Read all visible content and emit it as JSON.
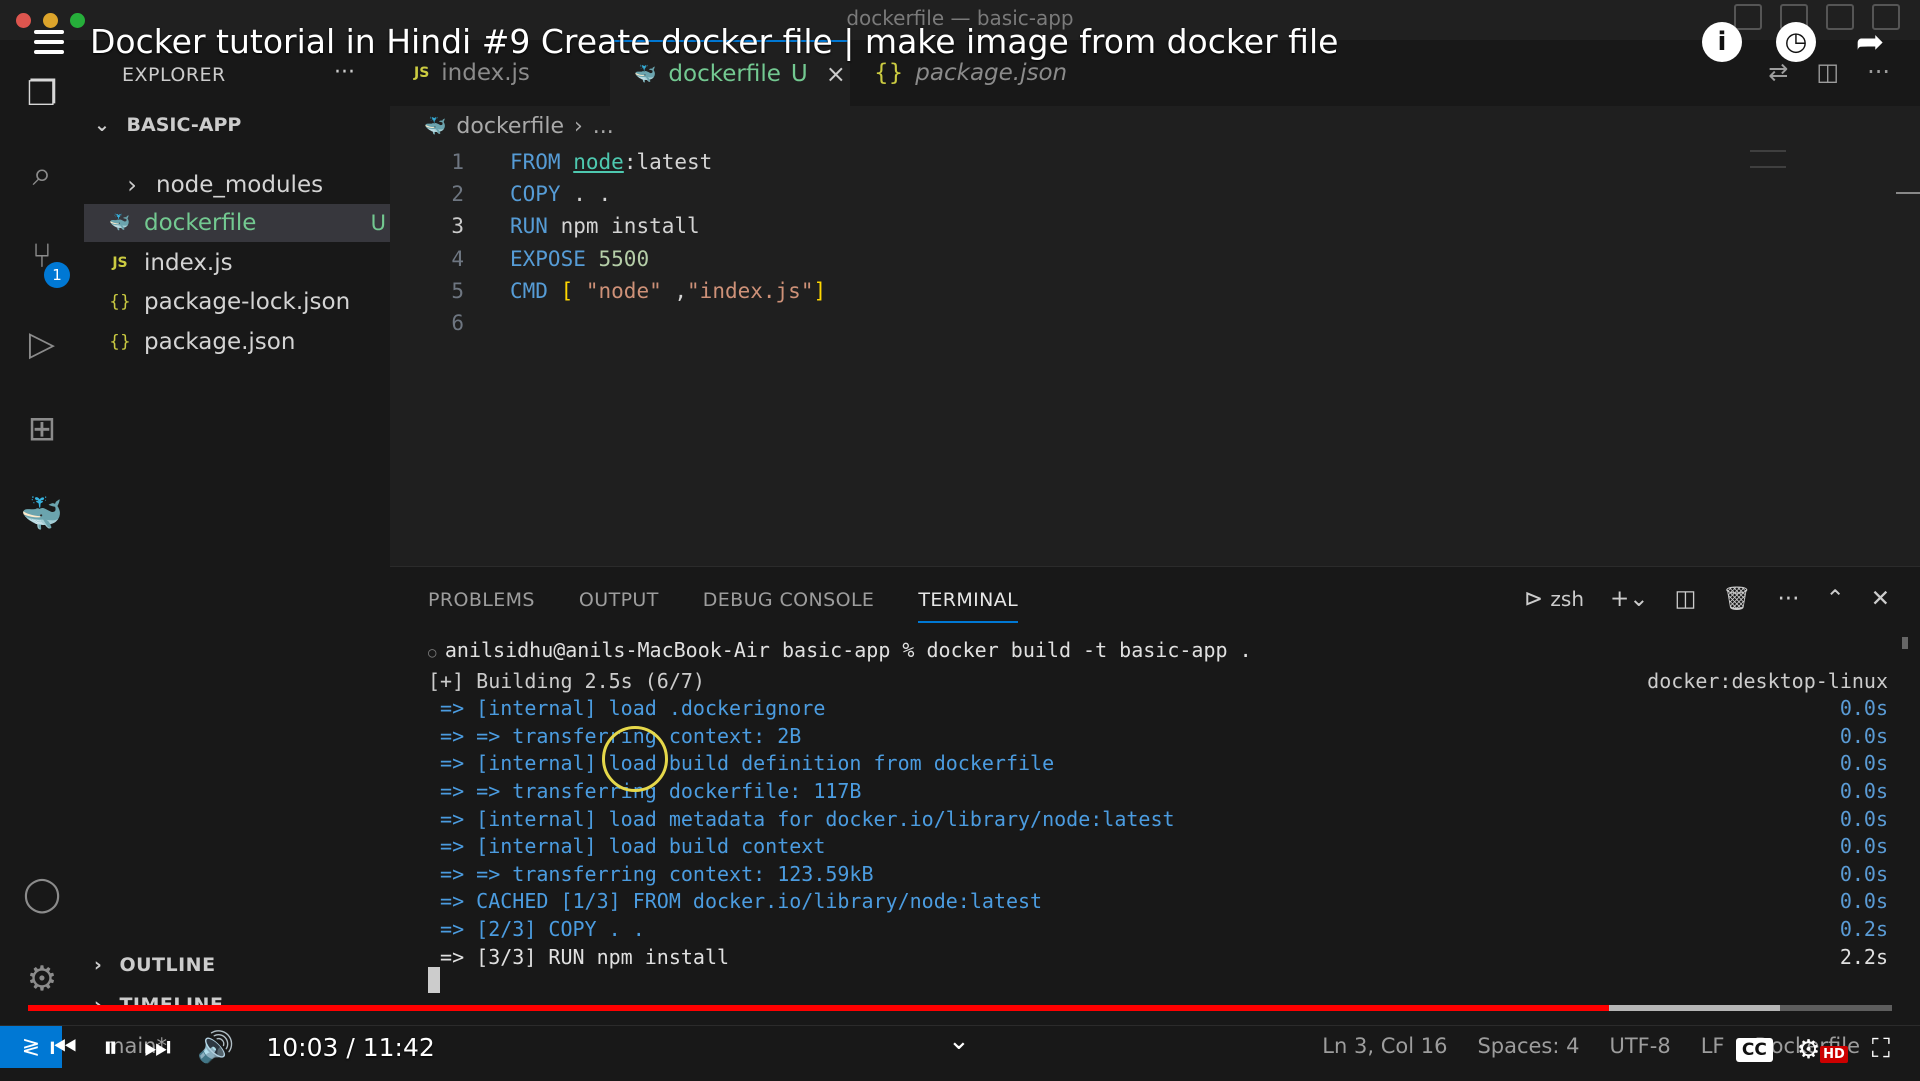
{
  "window": {
    "title": "dockerfile — basic-app",
    "traffic_colors": [
      "#ff5f57",
      "#febc2e",
      "#28c840"
    ]
  },
  "video": {
    "title": "Docker tutorial in Hindi #9 Create docker file | make image from docker file",
    "time": "10:03 / 11:42",
    "progress": 0.848,
    "buffered": 0.94,
    "cc_label": "CC",
    "hd_label": "HD",
    "info_icon": "info-icon",
    "watch_later_icon": "clock-icon",
    "share_icon": "share-icon"
  },
  "sidebar": {
    "title": "EXPLORER",
    "more": "···",
    "folder": "BASIC-APP",
    "items": [
      {
        "label": "node_modules",
        "icon": "›",
        "status": ""
      },
      {
        "label": "dockerfile",
        "icon": "🐳",
        "status": "U"
      },
      {
        "label": "index.js",
        "icon": "JS",
        "status": ""
      },
      {
        "label": "package-lock.json",
        "icon": "{}",
        "status": ""
      },
      {
        "label": "package.json",
        "icon": "{}",
        "status": ""
      }
    ],
    "outline": "OUTLINE",
    "timeline": "TIMELINE"
  },
  "tabs": [
    {
      "label": "index.js",
      "icon": "JS"
    },
    {
      "label": "dockerfile",
      "icon": "🐳",
      "status": "U",
      "close": "×"
    },
    {
      "label": "package.json",
      "icon": "{}"
    }
  ],
  "breadcrumb": {
    "file": "dockerfile",
    "sep": "›",
    "rest": "..."
  },
  "editor": {
    "lines": [
      {
        "n": "1",
        "kw": "FROM",
        "img": "node",
        "rest": ":latest"
      },
      {
        "n": "2",
        "kw": "COPY",
        "rest": " . ."
      },
      {
        "n": "3",
        "kw": "RUN",
        "rest": " npm install"
      },
      {
        "n": "4",
        "kw": "EXPOSE",
        "num": "5500"
      },
      {
        "n": "5",
        "kw": "CMD",
        "p1": " [ ",
        "s1": "\"node\"",
        "p2": " ,",
        "s2": "\"index.js\"",
        "p3": "]"
      },
      {
        "n": "6"
      }
    ]
  },
  "panel": {
    "tabs": [
      "PROBLEMS",
      "OUTPUT",
      "DEBUG CONSOLE",
      "TERMINAL"
    ],
    "shell": "zsh",
    "prompt": "anilsidhu@anils-MacBook-Air basic-app % docker build -t basic-app .",
    "lines": [
      {
        "text": "[+] Building 2.5s (6/7)",
        "right": "docker:desktop-linux"
      },
      {
        "text": " => [internal] load .dockerignore",
        "right": "0.0s"
      },
      {
        "text": " => => transferring context: 2B",
        "right": "0.0s"
      },
      {
        "text": " => [internal] load build definition from dockerfile",
        "right": "0.0s"
      },
      {
        "text": " => => transferring dockerfile: 117B",
        "right": "0.0s"
      },
      {
        "text": " => [internal] load metadata for docker.io/library/node:latest",
        "right": "0.0s"
      },
      {
        "text": " => [internal] load build context",
        "right": "0.0s"
      },
      {
        "text": " => => transferring context: 123.59kB",
        "right": "0.0s"
      },
      {
        "text": " => CACHED [1/3] FROM docker.io/library/node:latest",
        "right": "0.0s"
      },
      {
        "text": " => [2/3] COPY . .",
        "right": "0.2s"
      },
      {
        "text": " => [3/3] RUN npm install",
        "right": "2.2s"
      }
    ]
  },
  "statusbar": {
    "branch": "main*",
    "items": [
      "Ln 3, Col 16",
      "Spaces: 4",
      "UTF-8",
      "LF",
      "Dockerfile"
    ]
  }
}
